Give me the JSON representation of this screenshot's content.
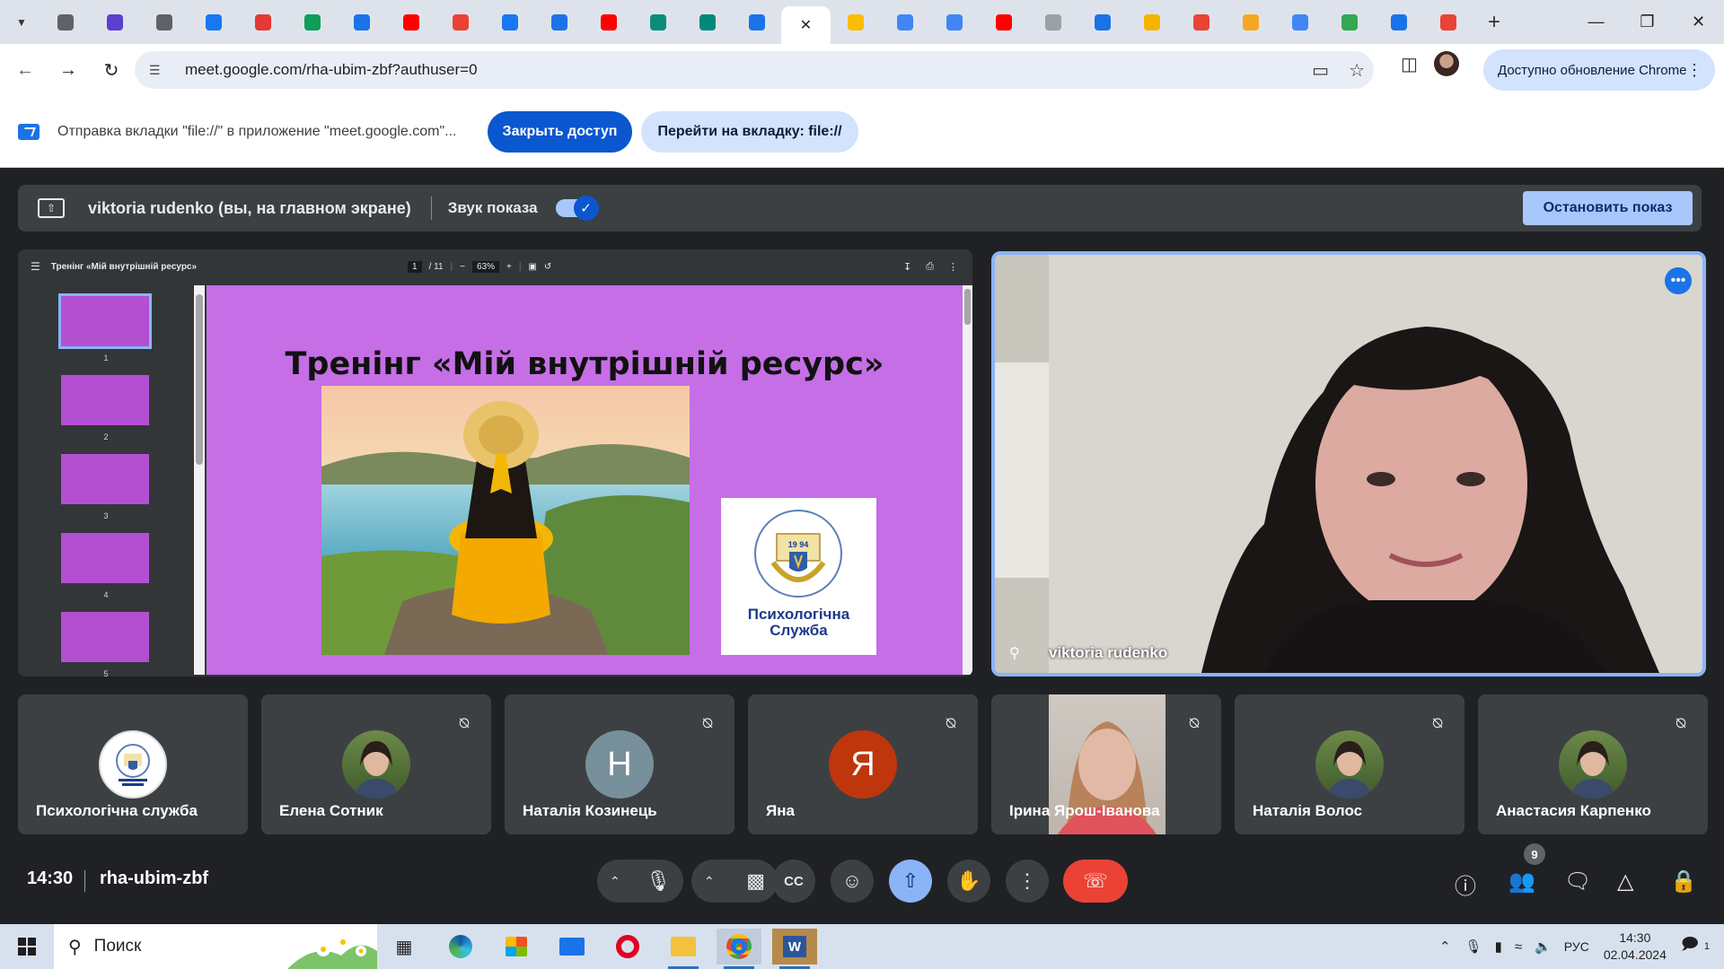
{
  "browser": {
    "tabs": [
      {
        "icon": "chrome-icon",
        "color": "#5f6368"
      },
      {
        "icon": "shield-icon",
        "color": "#5b3fd1"
      },
      {
        "icon": "globe-icon",
        "color": "#5f6368"
      },
      {
        "icon": "bird-icon",
        "color": "#1877f2"
      },
      {
        "icon": "heart-icon",
        "color": "#e53935"
      },
      {
        "icon": "sheets-icon",
        "color": "#0f9d58"
      },
      {
        "icon": "target-icon",
        "color": "#1a73e8"
      },
      {
        "icon": "youtube-icon",
        "color": "#ff0000"
      },
      {
        "icon": "gmail-icon",
        "color": "#ea4335"
      },
      {
        "icon": "facebook-icon",
        "color": "#1877f2"
      },
      {
        "icon": "circle-icon",
        "color": "#1a73e8"
      },
      {
        "icon": "youtube-icon",
        "color": "#ff0000"
      },
      {
        "icon": "edge-icon",
        "color": "#0b8d7a"
      },
      {
        "icon": "meet-icon",
        "color": "#00897b"
      },
      {
        "icon": "number-icon",
        "color": "#1a73e8"
      },
      {
        "icon": "close-icon",
        "color": "#222222",
        "active": true
      },
      {
        "icon": "drive-icon",
        "color": "#fbbc04"
      },
      {
        "icon": "docs-icon",
        "color": "#4285f4"
      },
      {
        "icon": "docs-icon",
        "color": "#4285f4"
      },
      {
        "icon": "youtube-icon",
        "color": "#ff0000"
      },
      {
        "icon": "compass-icon",
        "color": "#9aa0a6"
      },
      {
        "icon": "snowflake-icon",
        "color": "#1a73e8"
      },
      {
        "icon": "bookmark-icon",
        "color": "#f5b400"
      },
      {
        "icon": "gmail-icon",
        "color": "#ea4335"
      },
      {
        "icon": "bell-icon",
        "color": "#f5a623"
      },
      {
        "icon": "google-icon",
        "color": "#4285f4"
      },
      {
        "icon": "chat-icon",
        "color": "#34a853"
      },
      {
        "icon": "window-icon",
        "color": "#1a73e8"
      },
      {
        "icon": "gmail-icon",
        "color": "#ea4335"
      }
    ],
    "url": "meet.google.com/rha-ubim-zbf?authuser=0",
    "update_label": "Доступно обновление Chrome"
  },
  "infobar": {
    "message": "Отправка вкладки \"file://\" в приложение \"meet.google.com\"...",
    "close_access_label": "Закрыть доступ",
    "goto_label": "Перейти на вкладку: file://"
  },
  "presenter_bar": {
    "presenter": "viktoria rudenko (вы, на главном экране)",
    "sound_label": "Звук показа",
    "sound_on": true,
    "stop_label": "Остановить показ"
  },
  "pdf": {
    "doc_title": "Тренінг «Мій внутрішній ресурс»",
    "page_current": "1",
    "page_total": "/ 11",
    "zoom": "63%",
    "thumbnails": [
      "1",
      "2",
      "3",
      "4",
      "5"
    ],
    "slide_title": "Тренінг «Мій внутрішній ресурс»",
    "logo_year": "19 94",
    "logo_text": "Психологічна Служба"
  },
  "camera": {
    "name": "viktoria rudenko"
  },
  "participants": [
    {
      "name": "Психологічна служба",
      "type": "logo",
      "muted": false
    },
    {
      "name": "Елена Сотник",
      "type": "photo",
      "muted": true
    },
    {
      "name": "Наталія Козинець",
      "type": "letter",
      "letter": "Н",
      "color": "#78909c",
      "muted": true
    },
    {
      "name": "Яна",
      "type": "letter",
      "letter": "Я",
      "color": "#bf360c",
      "muted": true
    },
    {
      "name": "Ірина Ярош-Іванова",
      "type": "video",
      "muted": true
    },
    {
      "name": "Наталія Волос",
      "type": "photo",
      "muted": true
    },
    {
      "name": "Анастасия Карпенко",
      "type": "photo",
      "muted": true
    }
  ],
  "controls": {
    "time": "14:30",
    "meeting_code": "rha-ubim-zbf",
    "participants_count": "9"
  },
  "taskbar": {
    "search_placeholder": "Поиск",
    "lang": "РУС",
    "clock_time": "14:30",
    "clock_date": "02.04.2024",
    "notifications": "1"
  }
}
